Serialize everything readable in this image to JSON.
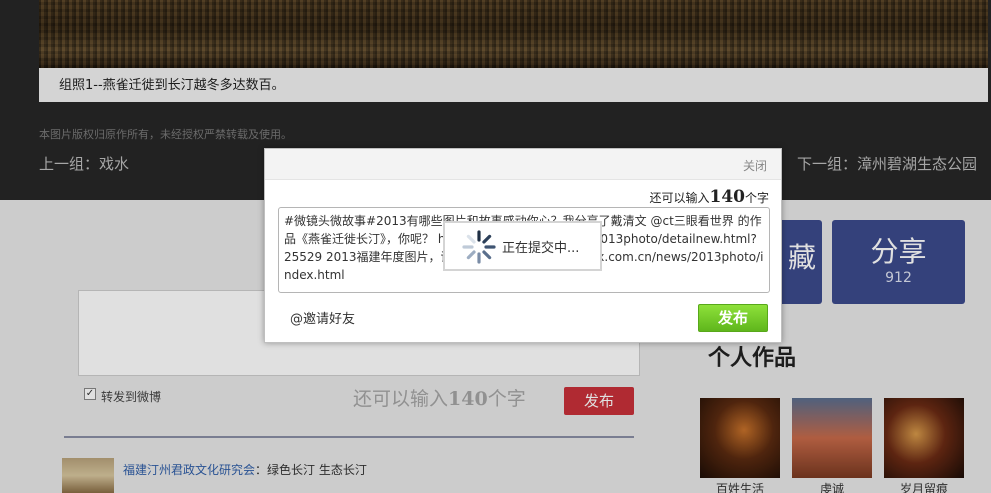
{
  "gallery": {
    "caption": "组照1--燕雀迁徙到长汀越冬多达数百。",
    "copyright": "本图片版权归原作所有，未经授权严禁转载及使用。",
    "prev": "上一组：戏水",
    "next": "下一组：漳州碧湖生态公园"
  },
  "stats": {
    "left_label": "藏",
    "share_label": "分享",
    "share_count": "912"
  },
  "personal": {
    "title": "个人作品",
    "works": [
      {
        "label": "百姓生活"
      },
      {
        "label": "虔诚"
      },
      {
        "label": "岁月留痕"
      }
    ]
  },
  "comment_form": {
    "forward_label": "转发到微博",
    "forward_checked": "✓",
    "remain_prefix": "还可以输入",
    "remain_count": "140",
    "remain_suffix": "个字",
    "publish_label": "发布"
  },
  "comments": [
    {
      "user": "福建汀州君政文化研究会",
      "separator": "：",
      "text": "绿色长汀 生态长汀"
    }
  ],
  "share_dialog": {
    "close_label": "关闭",
    "remain_prefix": "还可以输入",
    "remain_count": "140",
    "remain_suffix": "个字",
    "text": "#微镜头微故事#2013有哪些图片和故事感动你心？我分享了戴清文 @ct三眼看世界 的作品《燕雀迁徙长汀》，你呢？ http://photo.xxxx.com.cn/2013photo/detailnew.html?25529 2013福建年度图片，请登录参与 http://news.xxxx.com.cn/news/2013photo/index.html",
    "invite_label": "@邀请好友",
    "publish_label": "发布"
  },
  "loading": {
    "text": "正在提交中..."
  },
  "colors": {
    "share_box": "#3c4a8d",
    "publish_red": "#c9303a",
    "publish_green": "#6cc426",
    "link_blue": "#2f5ea8"
  },
  "icons": {
    "spinner": "loading-spinner-icon",
    "checkbox": "checkbox-icon"
  }
}
